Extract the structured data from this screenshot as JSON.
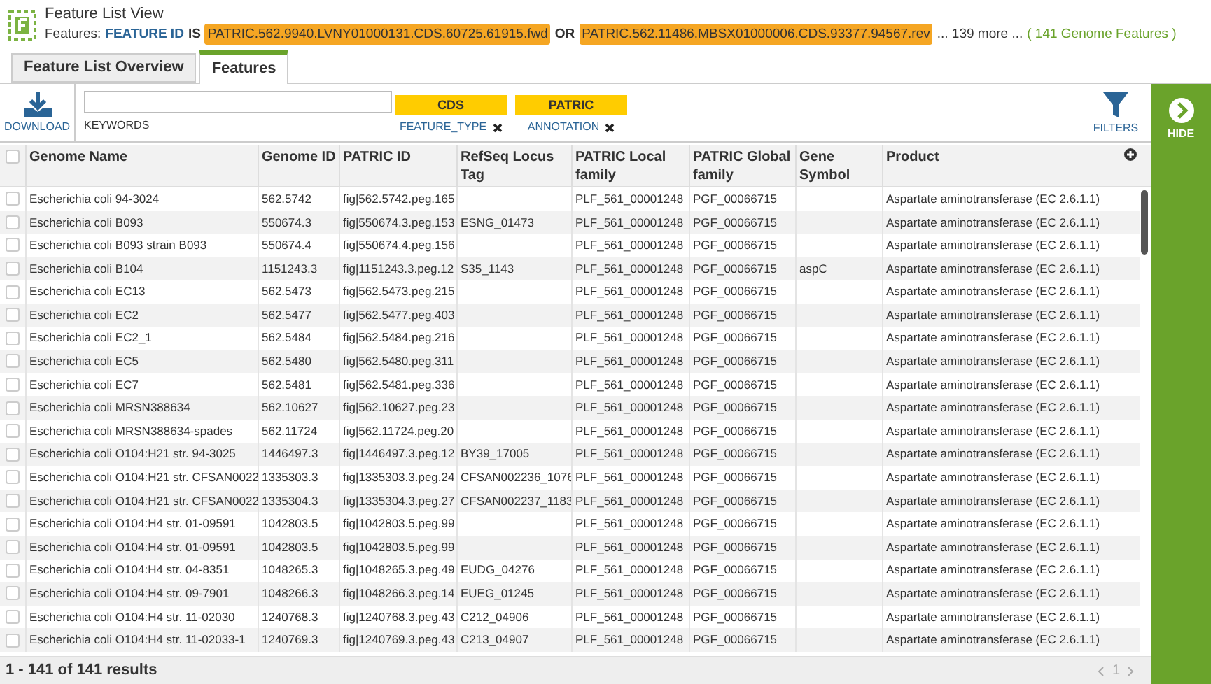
{
  "header": {
    "title": "Feature List View",
    "query_prefix": "Features:",
    "field": "FEATURE ID",
    "operator": "IS",
    "values": [
      "PATRIC.562.9940.LVNY01000131.CDS.60725.61915.fwd",
      "PATRIC.562.11486.MBSX01000006.CDS.93377.94567.rev"
    ],
    "joiner": "OR",
    "more": "... 139 more ...",
    "count_link": "( 141 Genome Features )"
  },
  "tabs": [
    {
      "label": "Feature List Overview",
      "selected": false
    },
    {
      "label": "Features",
      "selected": true
    }
  ],
  "toolbar": {
    "download": "DOWNLOAD",
    "keywords_label": "KEYWORDS",
    "filters": [
      {
        "value": "CDS",
        "field": "FEATURE_TYPE"
      },
      {
        "value": "PATRIC",
        "field": "ANNOTATION"
      }
    ],
    "filters_button": "FILTERS",
    "hide_button": "HIDE"
  },
  "table": {
    "select_all": {
      "checked": false
    },
    "columns": [
      "Genome Name",
      "Genome ID",
      "PATRIC ID",
      "RefSeq Locus Tag",
      "PATRIC Local family",
      "PATRIC Global family",
      "Gene Symbol",
      "Product"
    ],
    "rows": [
      {
        "selected": false,
        "cells": [
          "Escherichia coli 94-3024",
          "562.5742",
          "fig|562.5742.peg.165",
          "",
          "PLF_561_00001248",
          "PGF_00066715",
          "",
          "Aspartate aminotransferase (EC 2.6.1.1)"
        ]
      },
      {
        "selected": false,
        "cells": [
          "Escherichia coli B093",
          "550674.3",
          "fig|550674.3.peg.153",
          "ESNG_01473",
          "PLF_561_00001248",
          "PGF_00066715",
          "",
          "Aspartate aminotransferase (EC 2.6.1.1)"
        ]
      },
      {
        "selected": false,
        "cells": [
          "Escherichia coli B093 strain B093",
          "550674.4",
          "fig|550674.4.peg.156",
          "",
          "PLF_561_00001248",
          "PGF_00066715",
          "",
          "Aspartate aminotransferase (EC 2.6.1.1)"
        ]
      },
      {
        "selected": false,
        "cells": [
          "Escherichia coli B104",
          "1151243.3",
          "fig|1151243.3.peg.12",
          "S35_1143",
          "PLF_561_00001248",
          "PGF_00066715",
          "aspC",
          "Aspartate aminotransferase (EC 2.6.1.1)"
        ]
      },
      {
        "selected": false,
        "cells": [
          "Escherichia coli EC13",
          "562.5473",
          "fig|562.5473.peg.215",
          "",
          "PLF_561_00001248",
          "PGF_00066715",
          "",
          "Aspartate aminotransferase (EC 2.6.1.1)"
        ]
      },
      {
        "selected": false,
        "cells": [
          "Escherichia coli EC2",
          "562.5477",
          "fig|562.5477.peg.403",
          "",
          "PLF_561_00001248",
          "PGF_00066715",
          "",
          "Aspartate aminotransferase (EC 2.6.1.1)"
        ]
      },
      {
        "selected": false,
        "cells": [
          "Escherichia coli EC2_1",
          "562.5484",
          "fig|562.5484.peg.216",
          "",
          "PLF_561_00001248",
          "PGF_00066715",
          "",
          "Aspartate aminotransferase (EC 2.6.1.1)"
        ]
      },
      {
        "selected": false,
        "cells": [
          "Escherichia coli EC5",
          "562.5480",
          "fig|562.5480.peg.311",
          "",
          "PLF_561_00001248",
          "PGF_00066715",
          "",
          "Aspartate aminotransferase (EC 2.6.1.1)"
        ]
      },
      {
        "selected": false,
        "cells": [
          "Escherichia coli EC7",
          "562.5481",
          "fig|562.5481.peg.336",
          "",
          "PLF_561_00001248",
          "PGF_00066715",
          "",
          "Aspartate aminotransferase (EC 2.6.1.1)"
        ]
      },
      {
        "selected": false,
        "cells": [
          "Escherichia coli MRSN388634",
          "562.10627",
          "fig|562.10627.peg.23",
          "",
          "PLF_561_00001248",
          "PGF_00066715",
          "",
          "Aspartate aminotransferase (EC 2.6.1.1)"
        ]
      },
      {
        "selected": false,
        "cells": [
          "Escherichia coli MRSN388634-spades",
          "562.11724",
          "fig|562.11724.peg.20",
          "",
          "PLF_561_00001248",
          "PGF_00066715",
          "",
          "Aspartate aminotransferase (EC 2.6.1.1)"
        ]
      },
      {
        "selected": false,
        "cells": [
          "Escherichia coli O104:H21 str. 94-3025",
          "1446497.3",
          "fig|1446497.3.peg.12",
          "BY39_17005",
          "PLF_561_00001248",
          "PGF_00066715",
          "",
          "Aspartate aminotransferase (EC 2.6.1.1)"
        ]
      },
      {
        "selected": false,
        "cells": [
          "Escherichia coli O104:H21 str. CFSAN0022",
          "1335303.3",
          "fig|1335303.3.peg.24",
          "CFSAN002236_1076",
          "PLF_561_00001248",
          "PGF_00066715",
          "",
          "Aspartate aminotransferase (EC 2.6.1.1)"
        ]
      },
      {
        "selected": false,
        "cells": [
          "Escherichia coli O104:H21 str. CFSAN0022",
          "1335304.3",
          "fig|1335304.3.peg.27",
          "CFSAN002237_1183",
          "PLF_561_00001248",
          "PGF_00066715",
          "",
          "Aspartate aminotransferase (EC 2.6.1.1)"
        ]
      },
      {
        "selected": false,
        "cells": [
          "Escherichia coli O104:H4 str. 01-09591",
          "1042803.5",
          "fig|1042803.5.peg.99",
          "",
          "PLF_561_00001248",
          "PGF_00066715",
          "",
          "Aspartate aminotransferase (EC 2.6.1.1)"
        ]
      },
      {
        "selected": false,
        "cells": [
          "Escherichia coli O104:H4 str. 01-09591",
          "1042803.5",
          "fig|1042803.5.peg.99",
          "",
          "PLF_561_00001248",
          "PGF_00066715",
          "",
          "Aspartate aminotransferase (EC 2.6.1.1)"
        ]
      },
      {
        "selected": false,
        "cells": [
          "Escherichia coli O104:H4 str. 04-8351",
          "1048265.3",
          "fig|1048265.3.peg.49",
          "EUDG_04276",
          "PLF_561_00001248",
          "PGF_00066715",
          "",
          "Aspartate aminotransferase (EC 2.6.1.1)"
        ]
      },
      {
        "selected": false,
        "cells": [
          "Escherichia coli O104:H4 str. 09-7901",
          "1048266.3",
          "fig|1048266.3.peg.14",
          "EUEG_01245",
          "PLF_561_00001248",
          "PGF_00066715",
          "",
          "Aspartate aminotransferase (EC 2.6.1.1)"
        ]
      },
      {
        "selected": false,
        "cells": [
          "Escherichia coli O104:H4 str. 11-02030",
          "1240768.3",
          "fig|1240768.3.peg.43",
          "C212_04906",
          "PLF_561_00001248",
          "PGF_00066715",
          "",
          "Aspartate aminotransferase (EC 2.6.1.1)"
        ]
      },
      {
        "selected": false,
        "cells": [
          "Escherichia coli O104:H4 str. 11-02033-1",
          "1240769.3",
          "fig|1240769.3.peg.43",
          "C213_04907",
          "PLF_561_00001248",
          "PGF_00066715",
          "",
          "Aspartate aminotransferase (EC 2.6.1.1)"
        ]
      }
    ]
  },
  "status_bar": {
    "results": "1 - 141 of 141 results",
    "page": "1"
  }
}
